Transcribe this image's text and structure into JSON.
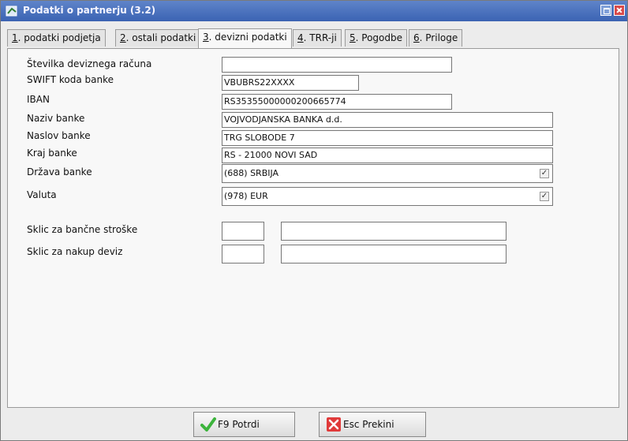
{
  "window": {
    "title": "Podatki o partnerju  (3.2)"
  },
  "tabs": [
    {
      "num": "1",
      "label": ". podatki podjetja"
    },
    {
      "num": "2",
      "label": ". ostali podatki"
    },
    {
      "num": "3",
      "label": ". devizni podatki"
    },
    {
      "num": "4",
      "label": ". TRR-ji"
    },
    {
      "num": "5",
      "label": ". Pogodbe"
    },
    {
      "num": "6",
      "label": ". Priloge"
    }
  ],
  "form": {
    "account": {
      "label": "Številka deviznega računa",
      "value": ""
    },
    "swift": {
      "label": "SWIFT koda banke",
      "value": "VBUBRS22XXXX"
    },
    "iban": {
      "label": "IBAN",
      "value": "RS35355000000200665774"
    },
    "bank_name": {
      "label": "Naziv banke",
      "value": "VOJVODJANSKA BANKA d.d."
    },
    "bank_address": {
      "label": "Naslov banke",
      "value": "TRG SLOBODE 7"
    },
    "bank_city": {
      "label": "Kraj banke",
      "value": "RS - 21000 NOVI SAD"
    },
    "bank_country": {
      "label": "Država banke",
      "value": "(688) SRBIJA"
    },
    "currency": {
      "label": "Valuta",
      "value": "(978) EUR"
    },
    "ref_costs": {
      "label": "Sklic za bančne stroške",
      "code": "",
      "value": ""
    },
    "ref_purchase": {
      "label": "Sklic za nakup deviz",
      "code": "",
      "value": ""
    }
  },
  "buttons": {
    "confirm": "F9 Potrdi",
    "cancel": "Esc Prekini"
  },
  "icons": {
    "confirm": "checkmark-icon",
    "cancel": "close-icon",
    "dropdown": "check-dropdown-icon"
  },
  "colors": {
    "titlebar": "#3b63b3",
    "confirm_icon": "#3cb43c",
    "cancel_icon": "#e03a3a"
  }
}
